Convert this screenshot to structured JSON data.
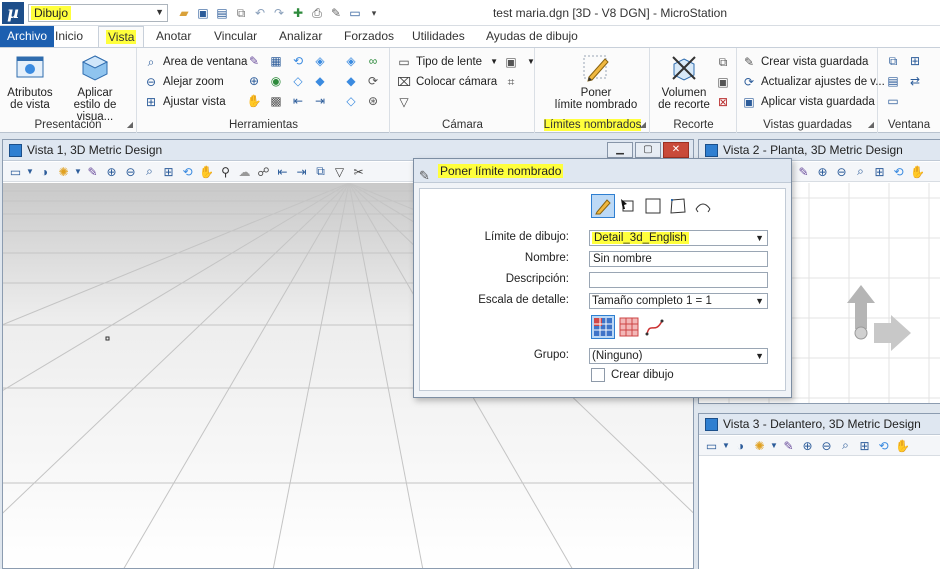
{
  "titlebar": {
    "workflow_value": "Dibujo",
    "title": "test maria.dgn [3D - V8 DGN] - MicroStation"
  },
  "tabs": [
    {
      "label": "Archivo"
    },
    {
      "label": "Inicio"
    },
    {
      "label": "Vista"
    },
    {
      "label": "Anotar"
    },
    {
      "label": "Vincular"
    },
    {
      "label": "Analizar"
    },
    {
      "label": "Forzados"
    },
    {
      "label": "Utilidades"
    },
    {
      "label": "Ayudas de dibujo"
    }
  ],
  "ribbon": {
    "presentacion": {
      "title": "Presentación",
      "atributos_line1": "Atributos",
      "atributos_line2": "de vista",
      "aplicar_line1": "Aplicar",
      "aplicar_line2": "estilo de visua..."
    },
    "herramientas": {
      "title": "Herramientas",
      "area_ventana": "Area de ventana",
      "alejar_zoom": "Alejar zoom",
      "ajustar_vista": "Ajustar vista"
    },
    "camara": {
      "title": "Cámara",
      "tipo_lente": "Tipo de lente",
      "colocar_camara": "Colocar cámara"
    },
    "limites": {
      "title": "Límites nombrados",
      "poner_line1": "Poner",
      "poner_line2": "límite nombrado"
    },
    "recorte": {
      "title": "Recorte",
      "volumen_line1": "Volumen",
      "volumen_line2": "de recorte"
    },
    "vistas_guardadas": {
      "title": "Vistas guardadas",
      "crear": "Crear vista guardada",
      "actualizar": "Actualizar ajustes de v...",
      "aplicar": "Aplicar vista guardada"
    },
    "ventana": {
      "title": "Ventana"
    }
  },
  "views": {
    "view1_title": "Vista 1, 3D Metric Design",
    "view2_title": "Vista 2 - Planta, 3D Metric Design",
    "view3_title": "Vista 3 - Delantero, 3D Metric Design"
  },
  "dialog": {
    "title": "Poner límite nombrado",
    "limite_label": "Límite de dibujo:",
    "limite_value": "Detail_3d_English",
    "nombre_label": "Nombre:",
    "nombre_value": "Sin nombre",
    "descripcion_label": "Descripción:",
    "descripcion_value": "",
    "escala_label": "Escala de detalle:",
    "escala_value": "Tamaño completo 1 = 1",
    "grupo_label": "Grupo:",
    "grupo_value": "(Ninguno)",
    "crear_dibujo_label": "Crear dibujo"
  },
  "colors": {
    "highlight": "#ffff3c",
    "file_tab": "#1c5fb0",
    "accent": "#2f7fd1"
  }
}
